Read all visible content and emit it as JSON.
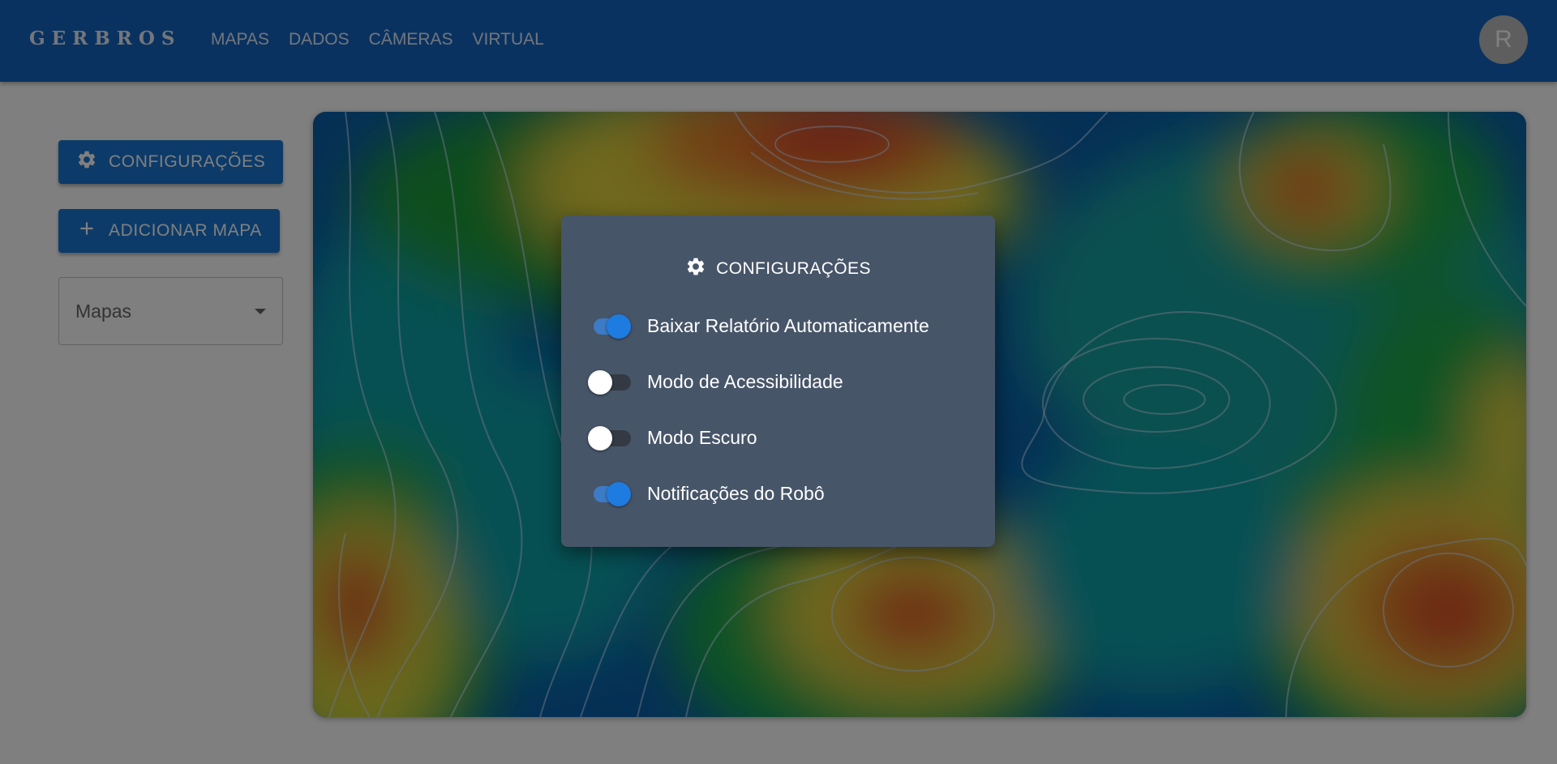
{
  "header": {
    "brand": "GERBROS",
    "nav": [
      "MAPAS",
      "DADOS",
      "CÂMERAS",
      "VIRTUAL"
    ],
    "avatar_initial": "R"
  },
  "sidebar": {
    "config_button": "CONFIGURAÇÕES",
    "add_map_button": "ADICIONAR MAPA",
    "maps_select": {
      "value": "Mapas"
    }
  },
  "dialog": {
    "title": "CONFIGURAÇÕES",
    "options": [
      {
        "label": "Baixar Relatório Automaticamente",
        "checked": true
      },
      {
        "label": "Modo de Acessibilidade",
        "checked": false
      },
      {
        "label": "Modo Escuro",
        "checked": false
      },
      {
        "label": "Notificações do Robô",
        "checked": true
      }
    ]
  },
  "colors": {
    "appbar": "#1565c0",
    "button": "#1976d2",
    "dialog": "#475569",
    "switch_on": "#1e7be0"
  },
  "icons": [
    "gear-icon",
    "plus-icon",
    "chevron-down-icon"
  ]
}
